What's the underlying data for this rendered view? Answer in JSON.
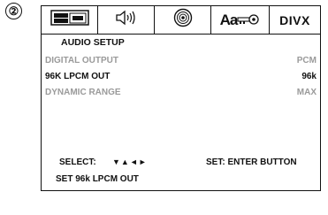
{
  "step_number": "②",
  "tabs": [
    {
      "name": "general-setup-icon"
    },
    {
      "name": "audio-speaker-icon"
    },
    {
      "name": "disc-icon"
    },
    {
      "name": "language-key-icon",
      "text": "Aa"
    },
    {
      "name": "divx-icon",
      "text": "DIVX"
    }
  ],
  "menu": {
    "title": "AUDIO SETUP",
    "items": [
      {
        "label": "DIGITAL OUTPUT",
        "value": "PCM"
      },
      {
        "label": "96K LPCM OUT",
        "value": "96k"
      },
      {
        "label": "DYNAMIC RANGE",
        "value": "MAX"
      }
    ],
    "select_label": "SELECT:",
    "select_arrows": "▼▲◄►",
    "enter_label": "SET: ENTER BUTTON",
    "footer_text": "SET 96k LPCM OUT"
  }
}
